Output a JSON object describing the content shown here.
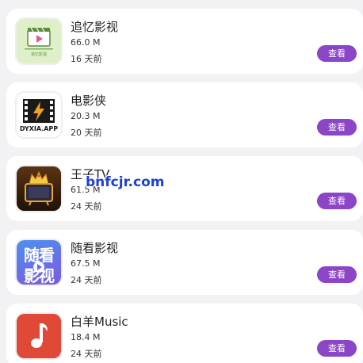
{
  "apps": [
    {
      "name": "追忆影视",
      "size": "66.0 M",
      "date": "16 天前",
      "button": "查看",
      "icon": "film-clapper-icon",
      "icon_caption": "追忆影视"
    },
    {
      "name": "电影侠",
      "size": "20.3 M",
      "date": "20 天前",
      "button": "查看",
      "icon": "lightning-film-icon",
      "icon_caption": "DYXIA.APP"
    },
    {
      "name": "王子TV",
      "size": "61.5 M",
      "date": "24 天前",
      "button": "查看",
      "icon": "crown-tv-icon"
    },
    {
      "name": "随看影视",
      "size": "67.5 M",
      "date": "24 天前",
      "button": "查看",
      "icon": "play-text-icon",
      "icon_caption_top": "随看",
      "icon_caption_bottom": "影视"
    },
    {
      "name": "白羊Music",
      "size": "18.4 M",
      "date": "24 天前",
      "button": "查看",
      "icon": "music-note-icon"
    }
  ],
  "watermark": "bnfcjr.com",
  "colors": {
    "button": "#8b45c6",
    "card": "#ffffff",
    "background": "#f2f2f5",
    "watermark": "#1e3fd8"
  }
}
